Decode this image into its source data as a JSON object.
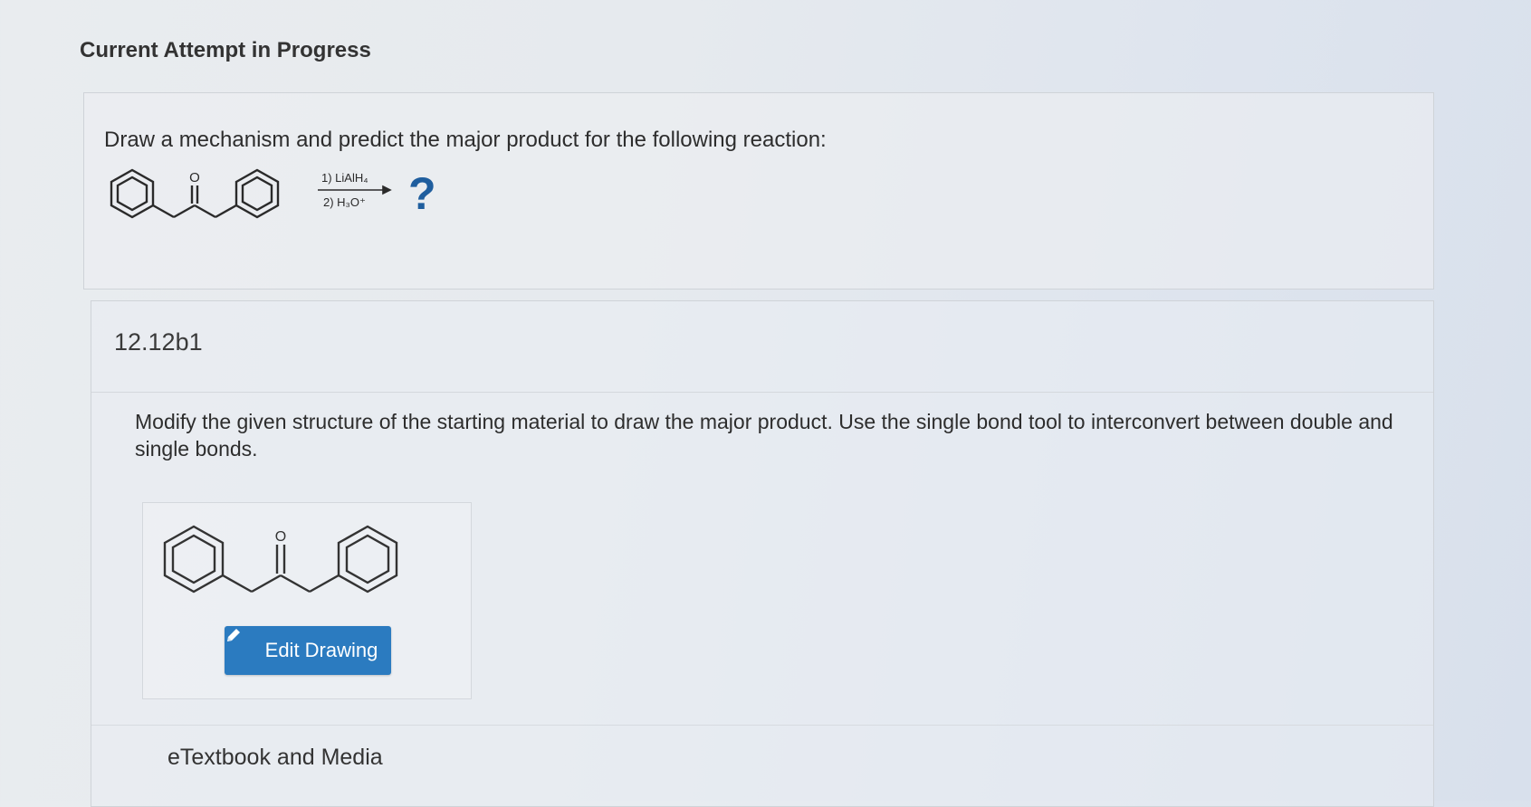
{
  "header": {
    "title": "Current Attempt in Progress"
  },
  "question": {
    "prompt": "Draw a mechanism and predict the major product for the following reaction:",
    "reagent_1": "1) LiAlH₄",
    "reagent_2": "2) H₃O⁺",
    "unknown_product": "?",
    "carbonyl_label": "O"
  },
  "part": {
    "id": "12.12b1",
    "instruction": "Modify the given structure of the starting material to draw the major product. Use the single bond tool to interconvert between double and single bonds.",
    "drawing": {
      "carbonyl_label": "O",
      "edit_button_label": "Edit Drawing",
      "edit_icon": "pencil-icon"
    },
    "etextbook_label": "eTextbook and Media"
  },
  "colors": {
    "accent": "#2b7bc0",
    "question_mark": "#1f5e9e",
    "text": "#2d2d2d"
  }
}
